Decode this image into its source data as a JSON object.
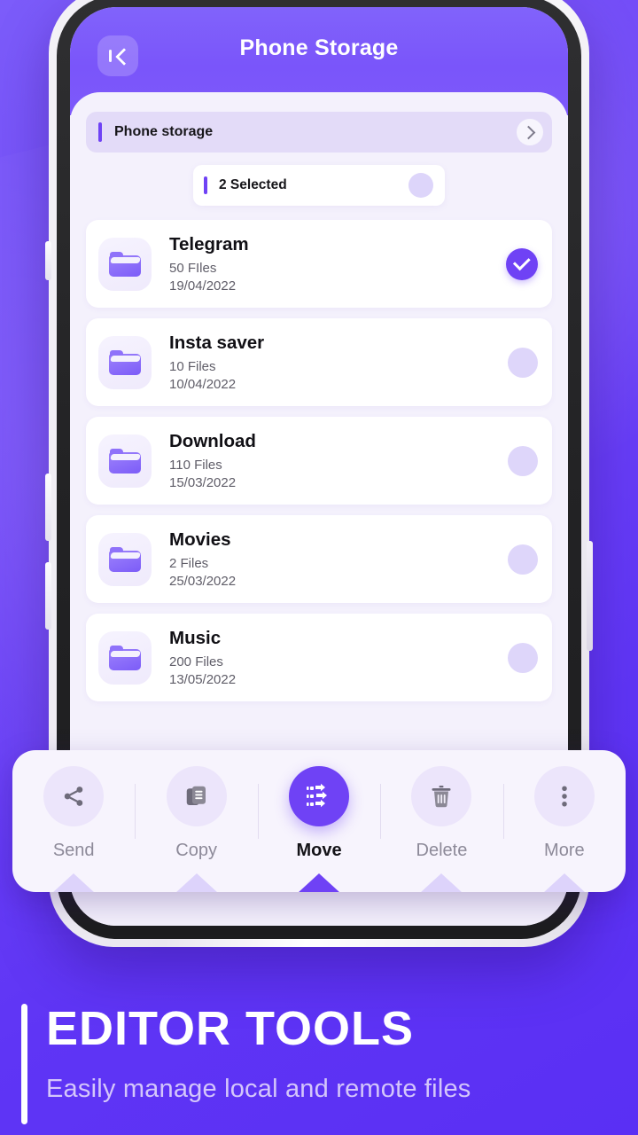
{
  "theme": {
    "background_gradient_start": "#7c5cfa",
    "background_gradient_end": "#5a2ff4",
    "accent": "#6f42f5",
    "panel_bg": "#f4f1fc",
    "card_bg": "#ffffff"
  },
  "app": {
    "header": {
      "title": "Phone Storage",
      "back_icon": "chevron-left-icon"
    },
    "breadcrumb": {
      "label": "Phone storage",
      "chevron_icon": "chevron-right-icon"
    },
    "selection": {
      "label": "2 Selected",
      "count": 2
    },
    "files": [
      {
        "name": "Telegram",
        "count": "50 FIles",
        "date": "19/04/2022",
        "selected": true,
        "icon": "folder-icon"
      },
      {
        "name": "Insta saver",
        "count": "10 Files",
        "date": "10/04/2022",
        "selected": false,
        "icon": "folder-icon"
      },
      {
        "name": "Download",
        "count": "110 Files",
        "date": "15/03/2022",
        "selected": false,
        "icon": "folder-icon"
      },
      {
        "name": "Movies",
        "count": "2 Files",
        "date": "25/03/2022",
        "selected": false,
        "icon": "folder-icon"
      },
      {
        "name": "Music",
        "count": "200 Files",
        "date": "13/05/2022",
        "selected": false,
        "icon": "folder-icon"
      }
    ],
    "actions": [
      {
        "label": "Send",
        "icon": "share-icon",
        "active": false
      },
      {
        "label": "Copy",
        "icon": "copy-icon",
        "active": false
      },
      {
        "label": "Move",
        "icon": "move-arrows-icon",
        "active": true
      },
      {
        "label": "Delete",
        "icon": "trash-icon",
        "active": false
      },
      {
        "label": "More",
        "icon": "more-vertical-icon",
        "active": false
      }
    ]
  },
  "promo": {
    "title": "EDITOR TOOLS",
    "subtitle": "Easily manage local and remote files"
  }
}
